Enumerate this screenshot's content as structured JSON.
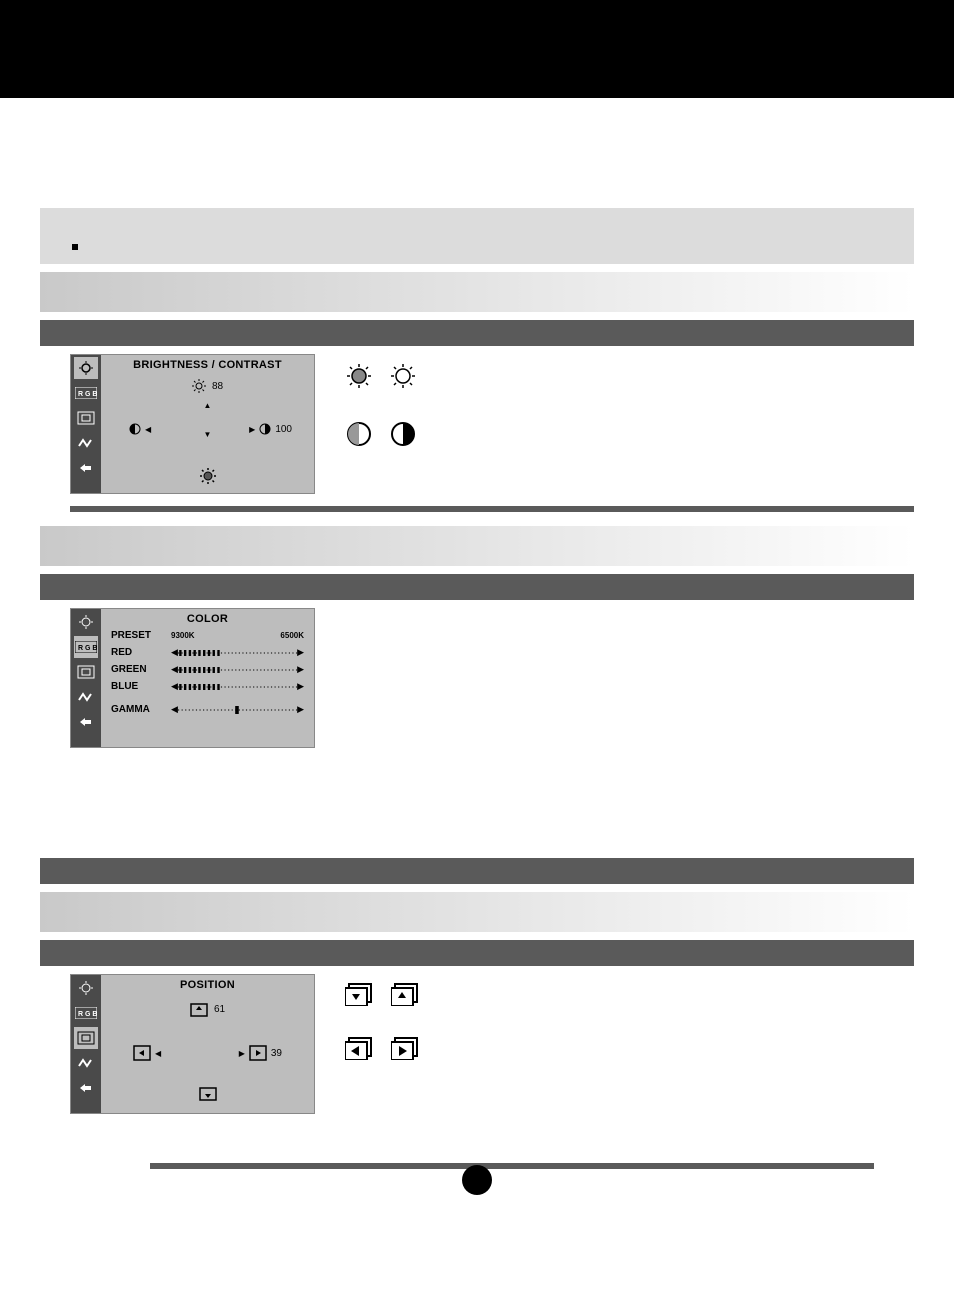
{
  "brightness_contrast": {
    "title": "BRIGHTNESS / CONTRAST",
    "brightness_value": "88",
    "contrast_value": "100"
  },
  "color": {
    "title": "COLOR",
    "preset_label": "PRESET",
    "preset_options": [
      "9300K",
      "6500K"
    ],
    "red_label": "RED",
    "green_label": "GREEN",
    "blue_label": "BLUE",
    "gamma_label": "GAMMA"
  },
  "position": {
    "title": "POSITION",
    "vertical_value": "61",
    "horizontal_value": "39"
  }
}
